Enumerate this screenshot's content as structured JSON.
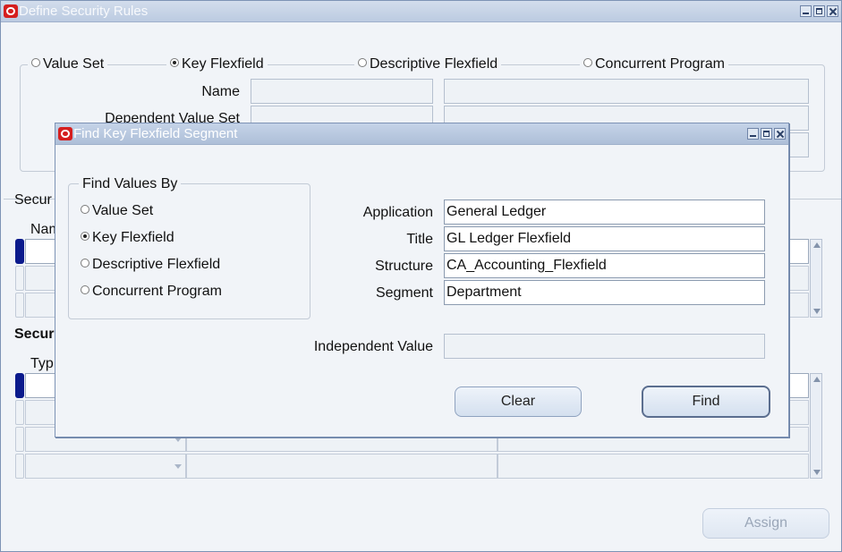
{
  "main_window": {
    "title": "Define Security Rules",
    "types": [
      "Value Set",
      "Key Flexfield",
      "Descriptive Flexfield",
      "Concurrent Program"
    ],
    "selected_type": "Key Flexfield",
    "name_label": "Name",
    "dependent_value_set_label": "Dependent Value Set",
    "security_rules_partial": "Secur",
    "name_column_partial": "Nam",
    "security_rule_elements_partial": "Secur",
    "type_column_partial": "Typ",
    "assign_label": "Assign"
  },
  "dialog": {
    "title": "Find Key Flexfield Segment",
    "group_title": "Find Values By",
    "options": [
      "Value Set",
      "Key Flexfield",
      "Descriptive Flexfield",
      "Concurrent Program"
    ],
    "selected_option": "Key Flexfield",
    "fields": {
      "application": {
        "label": "Application",
        "value": "General Ledger"
      },
      "title": {
        "label": "Title",
        "value": "GL Ledger Flexfield"
      },
      "structure": {
        "label": "Structure",
        "value": "CA_Accounting_Flexfield"
      },
      "segment": {
        "label": "Segment",
        "value": "Department"
      },
      "independent_value": {
        "label": "Independent Value",
        "value": ""
      }
    },
    "clear_label": "Clear",
    "find_label": "Find"
  },
  "colors": {
    "title_bar": "#aebfd8",
    "window_bg": "#f1f4f8",
    "record_marker": "#0b1a8c",
    "app_icon": "#d51f1f"
  }
}
